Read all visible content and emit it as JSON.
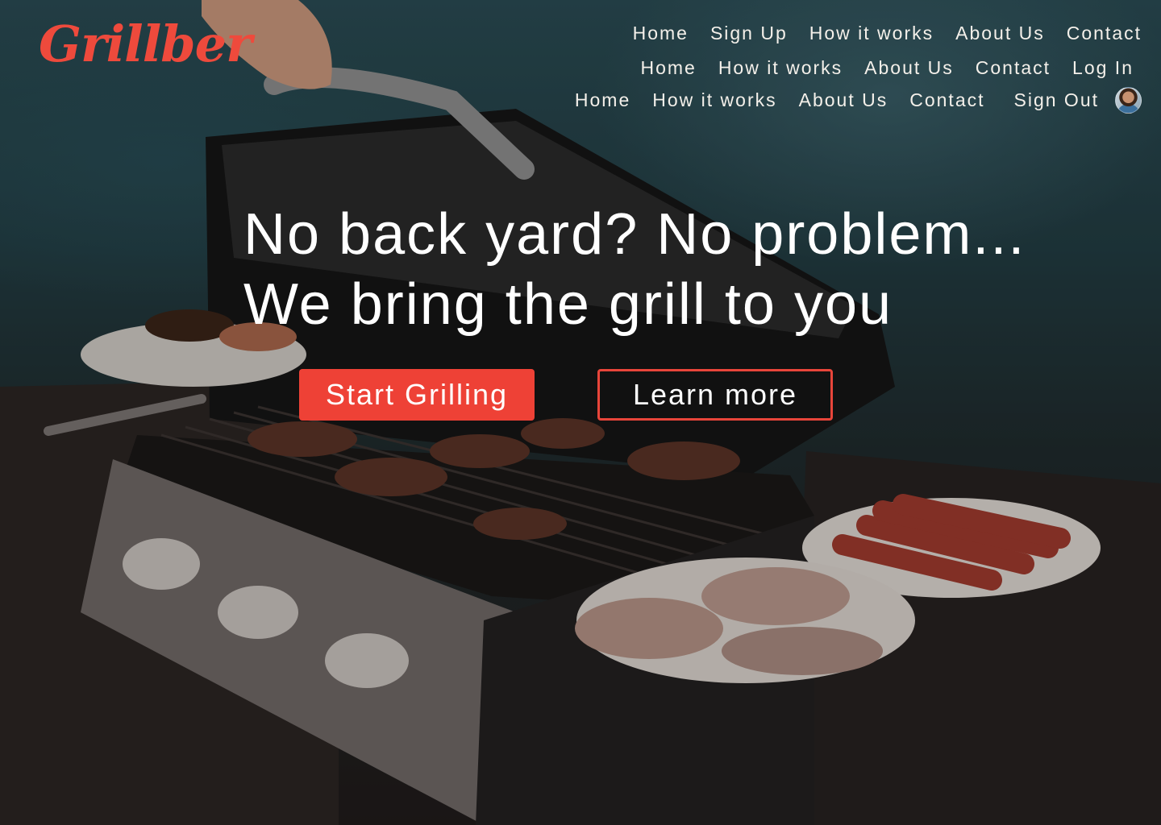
{
  "brand": {
    "name": "Grillber",
    "accent_color": "#ee4136"
  },
  "nav": {
    "row_1": [
      "Home",
      "Sign Up",
      "How it works",
      "About Us",
      "Contact"
    ],
    "row_2": [
      "Home",
      "How it works",
      "About Us",
      "Contact",
      "Log In"
    ],
    "row_3": [
      "Home",
      "How it works",
      "About Us",
      "Contact"
    ],
    "sign_out": "Sign Out",
    "avatar_icon": "user-avatar"
  },
  "hero": {
    "headline_line_1": "No back yard? No problem...",
    "headline_line_2": "We bring the grill to you",
    "primary_cta": "Start Grilling",
    "secondary_cta": "Learn more"
  }
}
